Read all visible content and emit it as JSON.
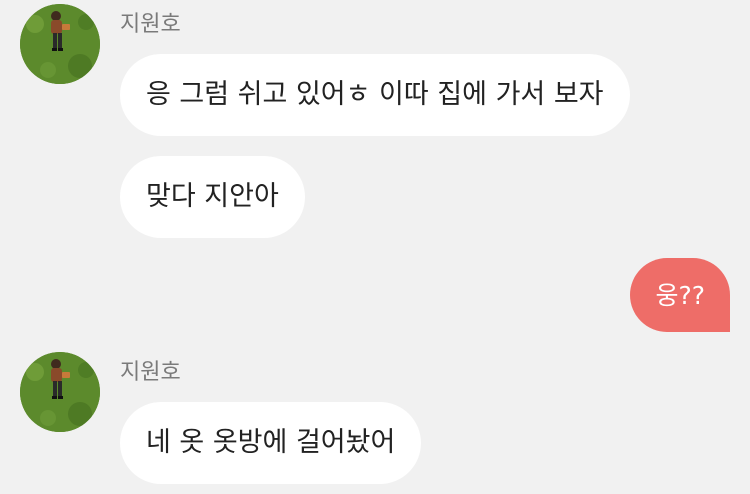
{
  "chat": {
    "messages": [
      {
        "sender": "지원호",
        "text": "응 그럼 쉬고 있어ㅎ 이따 집에 가서 보자",
        "outgoing": false
      },
      {
        "text": "맞다 지안아",
        "outgoing": false
      },
      {
        "text": "웅??",
        "outgoing": true
      },
      {
        "sender": "지원호",
        "text": "네 옷 옷방에 걸어놨어",
        "outgoing": false
      }
    ]
  },
  "colors": {
    "background": "#f1f1f1",
    "incoming_bubble": "#ffffff",
    "outgoing_bubble": "#ee6d68",
    "sender_name": "#7a7a7a"
  },
  "icons": {
    "avatar": "profile-photo-person-on-grass"
  }
}
